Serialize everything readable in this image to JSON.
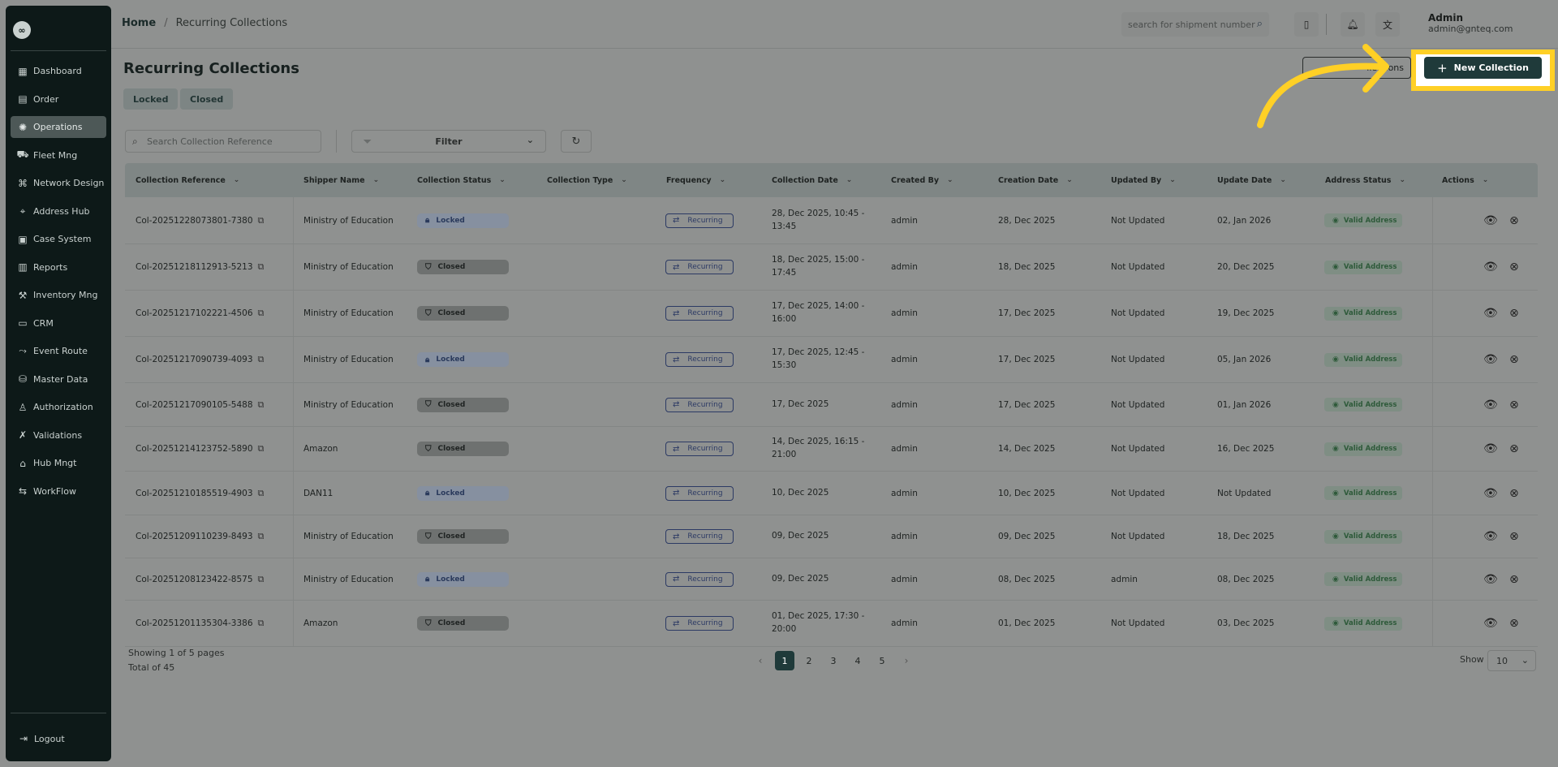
{
  "sidebar": {
    "logo": "∞",
    "items": [
      {
        "label": "Dashboard",
        "icon": "▦"
      },
      {
        "label": "Order",
        "icon": "▤"
      },
      {
        "label": "Operations",
        "icon": "✺",
        "active": true
      },
      {
        "label": "Fleet Mng",
        "icon": "⛟"
      },
      {
        "label": "Network Design",
        "icon": "⌘"
      },
      {
        "label": "Address Hub",
        "icon": "⌖"
      },
      {
        "label": "Case System",
        "icon": "▣"
      },
      {
        "label": "Reports",
        "icon": "▥"
      },
      {
        "label": "Inventory Mng",
        "icon": "⚒"
      },
      {
        "label": "CRM",
        "icon": "▭"
      },
      {
        "label": "Event Route",
        "icon": "⤳"
      },
      {
        "label": "Master Data",
        "icon": "⛁"
      },
      {
        "label": "Authorization",
        "icon": "♙"
      },
      {
        "label": "Validations",
        "icon": "✗"
      },
      {
        "label": "Hub Mngt",
        "icon": "⌂"
      },
      {
        "label": "WorkFlow",
        "icon": "⇆"
      }
    ],
    "logout": "Logout"
  },
  "header": {
    "breadcrumb_home": "Home",
    "breadcrumb_sep": "/",
    "breadcrumb_current": "Recurring Collections",
    "search_placeholder": "search for shipment number",
    "user_name": "Admin",
    "user_email": "admin@gnteq.com"
  },
  "page": {
    "title": "Recurring Collections",
    "chips": [
      "Locked",
      "Closed"
    ],
    "outline_button": "llections",
    "new_button": "New Collection",
    "search_placeholder": "Search Collection Reference",
    "filter_label": "Filter"
  },
  "table": {
    "headers": [
      "Collection Reference",
      "Shipper Name",
      "Collection Status",
      "Collection Type",
      "Frequency",
      "Collection Date",
      "Created By",
      "Creation Date",
      "Updated By",
      "Update Date",
      "Address Status",
      "Actions"
    ],
    "rows": [
      {
        "ref": "Col-20251228073801-7380",
        "shipper": "Ministry of Education",
        "status": "Locked",
        "freq": "Recurring",
        "date": "28, Dec 2025, 10:45 - 13:45",
        "created_by": "admin",
        "creation_date": "28, Dec 2025",
        "updated_by": "Not Updated",
        "update_date": "02, Jan 2026",
        "address": "Valid Address"
      },
      {
        "ref": "Col-20251218112913-5213",
        "shipper": "Ministry of Education",
        "status": "Closed",
        "freq": "Recurring",
        "date": "18, Dec 2025, 15:00 - 17:45",
        "created_by": "admin",
        "creation_date": "18, Dec 2025",
        "updated_by": "Not Updated",
        "update_date": "20, Dec 2025",
        "address": "Valid Address"
      },
      {
        "ref": "Col-20251217102221-4506",
        "shipper": "Ministry of Education",
        "status": "Closed",
        "freq": "Recurring",
        "date": "17, Dec 2025, 14:00 - 16:00",
        "created_by": "admin",
        "creation_date": "17, Dec 2025",
        "updated_by": "Not Updated",
        "update_date": "19, Dec 2025",
        "address": "Valid Address"
      },
      {
        "ref": "Col-20251217090739-4093",
        "shipper": "Ministry of Education",
        "status": "Locked",
        "freq": "Recurring",
        "date": "17, Dec 2025, 12:45 - 15:30",
        "created_by": "admin",
        "creation_date": "17, Dec 2025",
        "updated_by": "Not Updated",
        "update_date": "05, Jan 2026",
        "address": "Valid Address"
      },
      {
        "ref": "Col-20251217090105-5488",
        "shipper": "Ministry of Education",
        "status": "Closed",
        "freq": "Recurring",
        "date": "17, Dec 2025",
        "created_by": "admin",
        "creation_date": "17, Dec 2025",
        "updated_by": "Not Updated",
        "update_date": "01, Jan 2026",
        "address": "Valid Address"
      },
      {
        "ref": "Col-20251214123752-5890",
        "shipper": "Amazon",
        "status": "Closed",
        "freq": "Recurring",
        "date": "14, Dec 2025, 16:15 - 21:00",
        "created_by": "admin",
        "creation_date": "14, Dec 2025",
        "updated_by": "Not Updated",
        "update_date": "16, Dec 2025",
        "address": "Valid Address"
      },
      {
        "ref": "Col-20251210185519-4903",
        "shipper": "DAN11",
        "status": "Locked",
        "freq": "Recurring",
        "date": "10, Dec 2025",
        "created_by": "admin",
        "creation_date": "10, Dec 2025",
        "updated_by": "Not Updated",
        "update_date": "Not Updated",
        "address": "Valid Address"
      },
      {
        "ref": "Col-20251209110239-8493",
        "shipper": "Ministry of Education",
        "status": "Closed",
        "freq": "Recurring",
        "date": "09, Dec 2025",
        "created_by": "admin",
        "creation_date": "09, Dec 2025",
        "updated_by": "Not Updated",
        "update_date": "18, Dec 2025",
        "address": "Valid Address"
      },
      {
        "ref": "Col-20251208123422-8575",
        "shipper": "Ministry of Education",
        "status": "Locked",
        "freq": "Recurring",
        "date": "09, Dec 2025",
        "created_by": "admin",
        "creation_date": "08, Dec 2025",
        "updated_by": "admin",
        "update_date": "08, Dec 2025",
        "address": "Valid Address"
      },
      {
        "ref": "Col-20251201135304-3386",
        "shipper": "Amazon",
        "status": "Closed",
        "freq": "Recurring",
        "date": "01, Dec 2025, 17:30 - 20:00",
        "created_by": "admin",
        "creation_date": "01, Dec 2025",
        "updated_by": "Not Updated",
        "update_date": "03, Dec 2025",
        "address": "Valid Address"
      }
    ]
  },
  "pagination": {
    "showing": "Showing 1 of 5 pages",
    "total": "Total of 45",
    "pages": [
      "1",
      "2",
      "3",
      "4",
      "5"
    ],
    "current": "1",
    "show_label": "Show",
    "page_size": "10"
  },
  "colors": {
    "accent": "#1f3a3a",
    "highlight": "#ffd026",
    "sidebar": "#0d1918"
  }
}
